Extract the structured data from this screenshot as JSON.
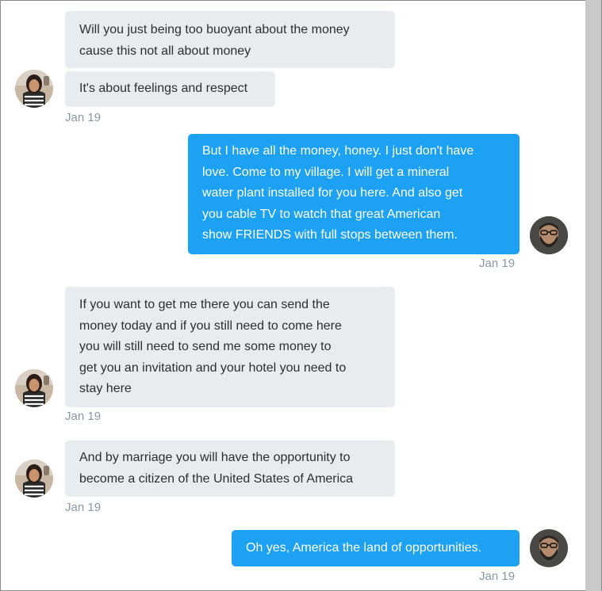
{
  "conversation": {
    "messages": [
      {
        "sender": "them",
        "lines": [
          "Will you just being too buoyant about the money",
          "cause this not all about money"
        ]
      },
      {
        "sender": "them",
        "lines": [
          "It's about feelings and respect"
        ],
        "timestamp": "Jan 19"
      },
      {
        "sender": "me",
        "lines": [
          "But I have all the money, honey. I just don't have",
          "love. Come to my village. I will get a mineral",
          "water plant installed for you here. And also get",
          "you cable TV to watch that great American",
          "show FRIENDS with full stops between them."
        ],
        "timestamp": "Jan 19"
      },
      {
        "sender": "them",
        "lines": [
          "If you want to get me there you can send the",
          "money today and if you still need to come here",
          "you will still need to send me some money to",
          "get you an invitation and your hotel you need to",
          "stay here"
        ],
        "timestamp": "Jan 19"
      },
      {
        "sender": "them",
        "lines": [
          "And by marriage you will have the opportunity to",
          "become a citizen of the United States of America"
        ],
        "timestamp": "Jan 19"
      },
      {
        "sender": "me",
        "lines": [
          "Oh yes, America the land of opportunities."
        ],
        "timestamp": "Jan 19"
      }
    ]
  },
  "colors": {
    "received_bubble": "#e6ecf0",
    "sent_bubble": "#1da1f2",
    "timestamp_text": "#8899a6",
    "message_text": "#292f33"
  },
  "icons": {
    "other_avatar": "woman-avatar",
    "my_avatar": "bearded-man-avatar"
  }
}
